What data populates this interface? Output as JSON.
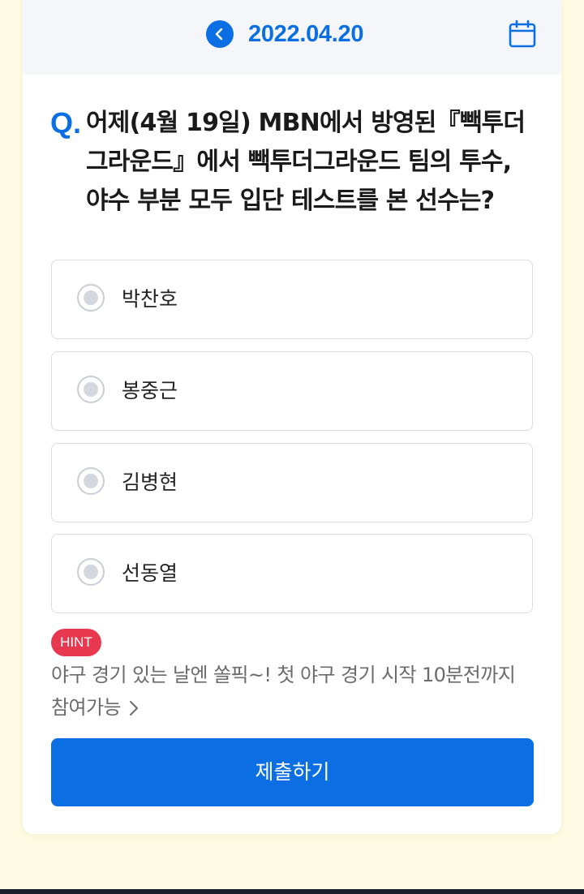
{
  "header": {
    "date": "2022.04.20",
    "prev_icon": "chevron-left-icon",
    "calendar_icon": "calendar-icon"
  },
  "question": {
    "mark": "Q.",
    "lines": [
      "어제(4월 19일) MBN에서 방영된『빽투더",
      "그라운드』에서 빽투더그라운드 팀의 투수,",
      "야수 부분 모두 입단 테스트를 본 선수는?"
    ]
  },
  "options": [
    {
      "label": "박찬호",
      "selected": false
    },
    {
      "label": "봉중근",
      "selected": false
    },
    {
      "label": "김병현",
      "selected": false
    },
    {
      "label": "선동열",
      "selected": false
    }
  ],
  "hint": {
    "badge": "HINT",
    "line1": "야구 경기 있는 날엔 쏠픽~! 첫 야구 경기 시작 10분전까지",
    "line2": "참여가능"
  },
  "submit_label": "제출하기",
  "colors": {
    "accent": "#0b6fe3",
    "hint_badge": "#e8384f",
    "page_background": "#fdfbe3"
  }
}
